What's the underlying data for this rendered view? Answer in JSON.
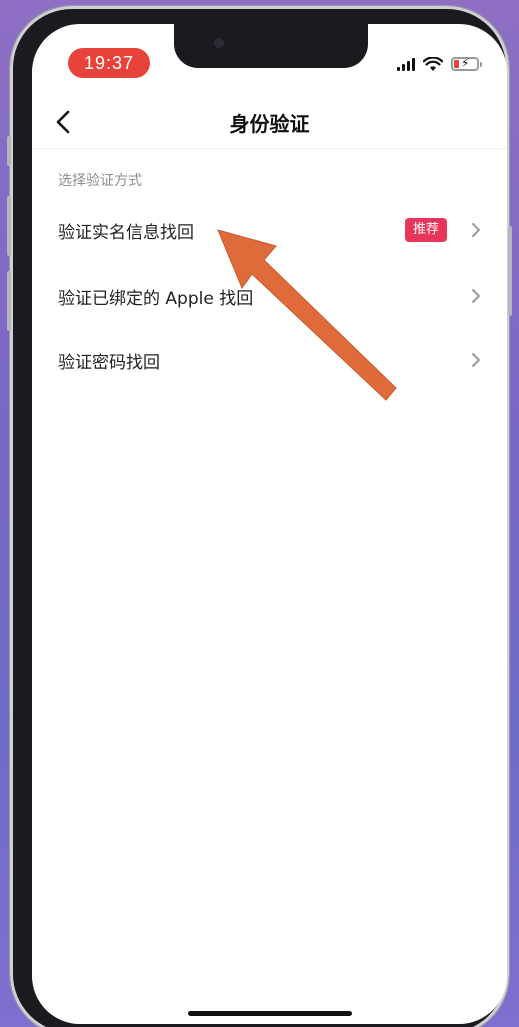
{
  "status_bar": {
    "time": "19:37",
    "icons": [
      "signal-icon",
      "wifi-icon",
      "battery-charging-icon"
    ]
  },
  "nav": {
    "title": "身份验证",
    "back_icon": "chevron-left-icon"
  },
  "section": {
    "label": "选择验证方式"
  },
  "options": [
    {
      "label": "验证实名信息找回",
      "badge": "推荐"
    },
    {
      "label": "验证已绑定的 Apple 找回"
    },
    {
      "label": "验证密码找回"
    }
  ],
  "colors": {
    "time_pill": "#e8433a",
    "badge": "#e8365a",
    "annotation_arrow": "#e06b3a"
  }
}
